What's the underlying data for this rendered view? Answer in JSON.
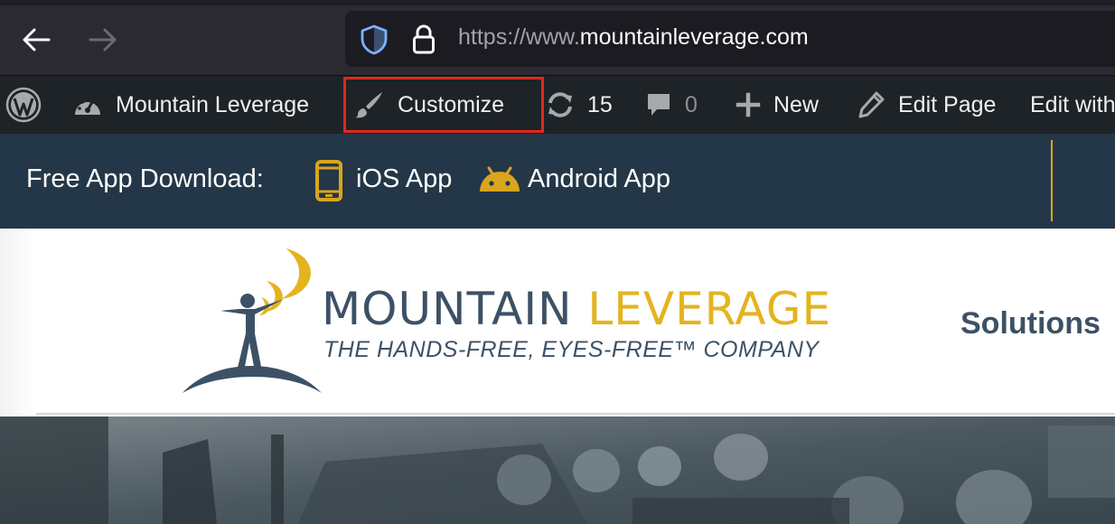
{
  "browser": {
    "url_scheme": "https://www.",
    "url_domain": "mountainleverage.com"
  },
  "admin_bar": {
    "site_name": "Mountain Leverage",
    "customize": "Customize",
    "updates_count": "15",
    "comments_count": "0",
    "new_label": "New",
    "edit_page": "Edit Page",
    "edit_with": "Edit with"
  },
  "top_bar": {
    "label": "Free App Download:",
    "ios": "iOS App",
    "android": "Android App"
  },
  "logo": {
    "name_part1": "MOUNTAIN",
    "name_part2": "LEVERAGE",
    "tagline": "THE HANDS-FREE, EYES-FREE™ COMPANY"
  },
  "nav": {
    "solutions": "Solutions"
  },
  "colors": {
    "accent_gold": "#e4b41f",
    "brand_dark": "#3d5166",
    "info_bar": "#243748",
    "admin_bar": "#1d2327",
    "highlight": "#e0281a"
  }
}
